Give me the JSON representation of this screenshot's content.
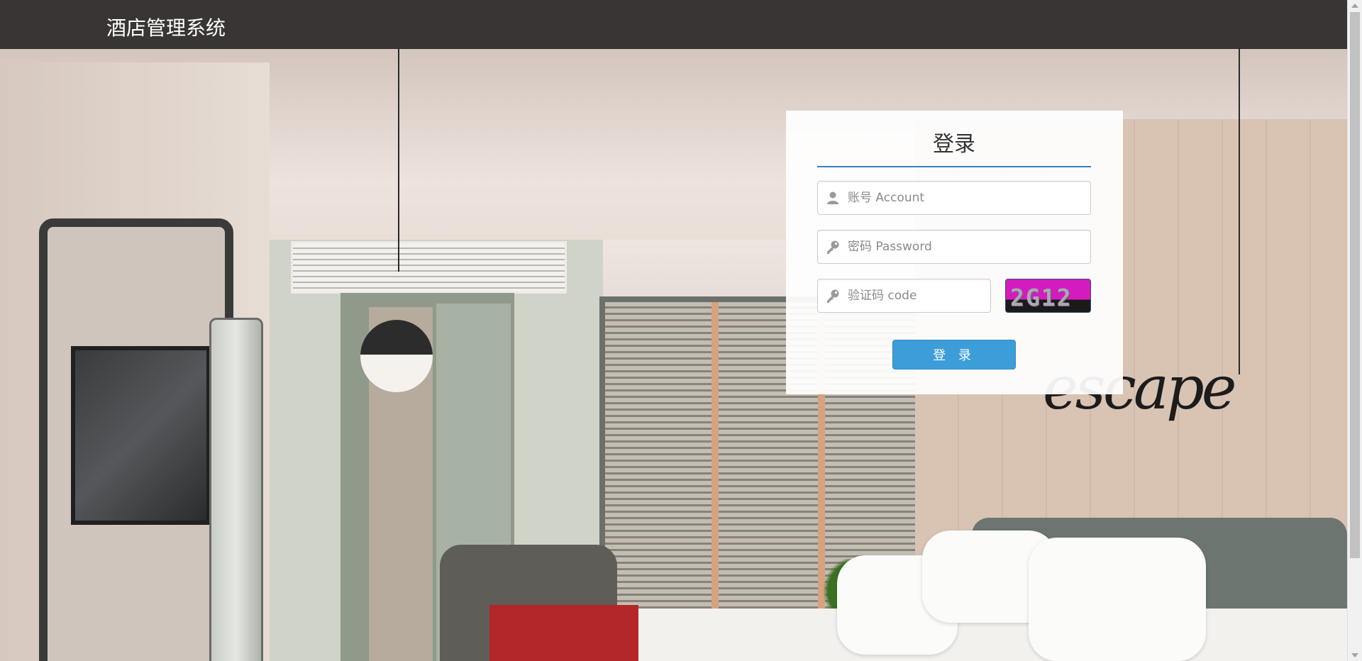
{
  "header": {
    "app_title": "酒店管理系统"
  },
  "background": {
    "sign_text": "escape"
  },
  "login": {
    "title": "登录",
    "account_placeholder": "账号 Account",
    "password_placeholder": "密码 Password",
    "code_placeholder": "验证码 code",
    "captcha_text": "2G12",
    "submit_label": "登 录"
  },
  "icons": {
    "account": "user-icon",
    "password": "key-icon",
    "code": "key-icon"
  },
  "colors": {
    "topbar": "#393534",
    "accent": "#3a7fbd",
    "button": "#3d9dd9",
    "captcha_bg": "#d41bbd"
  }
}
